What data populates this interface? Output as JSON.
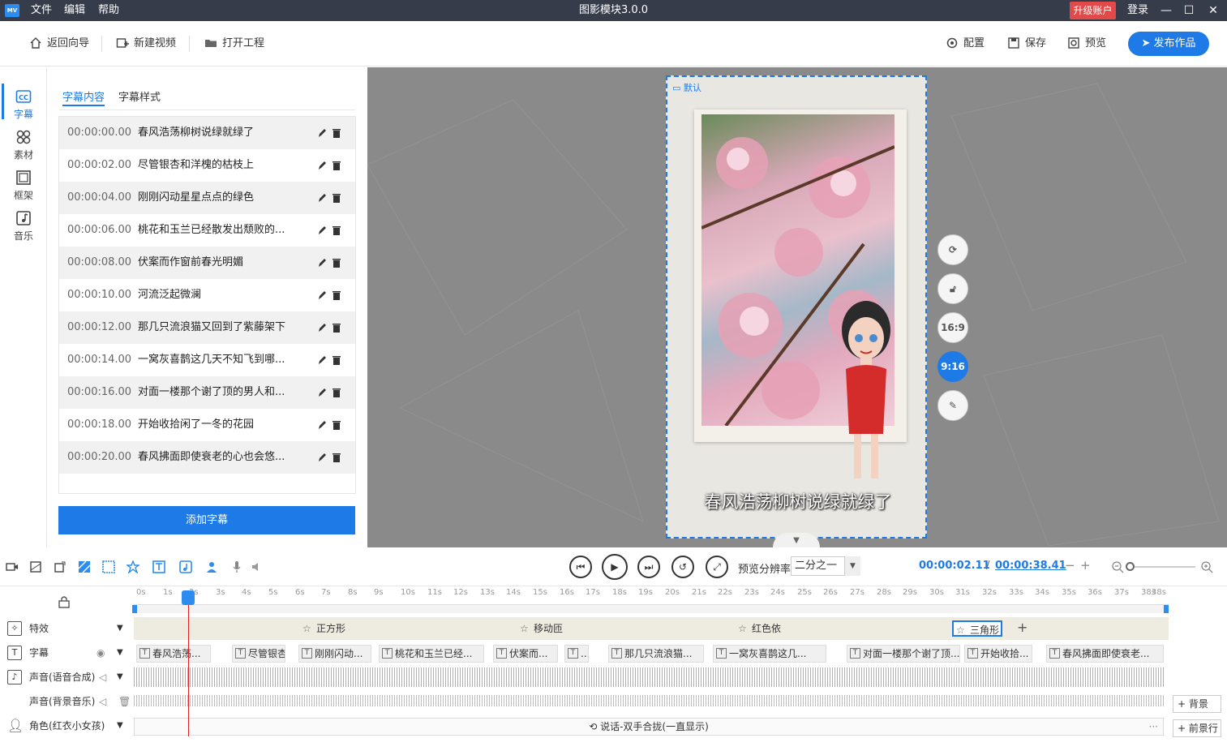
{
  "titlebar": {
    "logo": "MV",
    "menus": [
      "文件",
      "编辑",
      "帮助"
    ],
    "app_title": "图影模块3.0.0",
    "upgrade": "升级账户",
    "login": "登录",
    "min": "—",
    "max": "☐",
    "close": "✕"
  },
  "toolbar": {
    "back": "返回向导",
    "new_video": "新建视频",
    "open_project": "打开工程",
    "config": "配置",
    "save": "保存",
    "preview": "预览",
    "publish": "发布作品"
  },
  "sidebar": {
    "items": [
      {
        "label": "字幕",
        "icon": "cc-icon"
      },
      {
        "label": "素材",
        "icon": "grid-icon"
      },
      {
        "label": "框架",
        "icon": "frame-icon"
      },
      {
        "label": "音乐",
        "icon": "music-icon"
      }
    ]
  },
  "panel": {
    "tabs": [
      "字幕内容",
      "字幕样式"
    ],
    "rows": [
      {
        "time": "00:00:00.00",
        "text": "春风浩荡柳树说绿就绿了"
      },
      {
        "time": "00:00:02.00",
        "text": "尽管银杏和洋槐的枯枝上"
      },
      {
        "time": "00:00:04.00",
        "text": "刚刚闪动星星点点的绿色"
      },
      {
        "time": "00:00:06.00",
        "text": "桃花和玉兰已经散发出颓败的..."
      },
      {
        "time": "00:00:08.00",
        "text": "伏案而作窗前春光明媚"
      },
      {
        "time": "00:00:10.00",
        "text": "河流泛起微澜"
      },
      {
        "time": "00:00:12.00",
        "text": "那几只流浪猫又回到了紫藤架下"
      },
      {
        "time": "00:00:14.00",
        "text": "一窝灰喜鹊这几天不知飞到哪..."
      },
      {
        "time": "00:00:16.00",
        "text": "对面一楼那个谢了顶的男人和..."
      },
      {
        "time": "00:00:18.00",
        "text": "开始收拾闲了一冬的花园"
      },
      {
        "time": "00:00:20.00",
        "text": "春风拂面即使衰老的心也会悠..."
      }
    ],
    "add_button": "添加字幕"
  },
  "preview": {
    "default_label": "默认",
    "caption": "春风浩荡柳树说绿就绿了",
    "side_buttons": [
      "16:9",
      "9:16"
    ],
    "collapse": "▼"
  },
  "playbar": {
    "res_label": "预览分辨率",
    "res_value": "二分之一",
    "time_current": "00:00:02.11",
    "time_sep": "/",
    "time_total": "00:00:38.41",
    "minus": "−",
    "plus": "+"
  },
  "timeline": {
    "ticks": [
      "0s",
      "1s",
      "2s",
      "3s",
      "4s",
      "5s",
      "6s",
      "7s",
      "8s",
      "9s",
      "10s",
      "11s",
      "12s",
      "13s",
      "14s",
      "15s",
      "16s",
      "17s",
      "18s",
      "19s",
      "20s",
      "21s",
      "22s",
      "23s",
      "24s",
      "25s",
      "26s",
      "27s",
      "28s",
      "29s",
      "30s",
      "31s",
      "32s",
      "33s",
      "34s",
      "35s",
      "36s",
      "37s",
      "38s",
      "38s"
    ],
    "tracks": {
      "effects": "特效",
      "subtitle": "字幕",
      "voice_tts": "声音(语音合成)",
      "voice_bgm": "声音(背景音乐)",
      "role": "角色(红衣小女孩)"
    },
    "fx_chips": [
      "正方形",
      "移动匝",
      "红色依",
      "三角形"
    ],
    "fx_add": "+",
    "sub_chips": [
      "春风浩荡...",
      "尽管银杏...",
      "刚刚闪动...",
      "桃花和玉兰已经...",
      "伏案而...",
      "...",
      "那几只流浪猫...",
      "一窝灰喜鹊这几...",
      "对面一楼那个谢了顶...",
      "开始收拾...",
      "春风拂面即使衰老..."
    ],
    "role_clip": "说话-双手合拢(一直显示)",
    "role_more": "···",
    "bg_button": "+ 背景",
    "fg_button": "+ 前景行"
  }
}
